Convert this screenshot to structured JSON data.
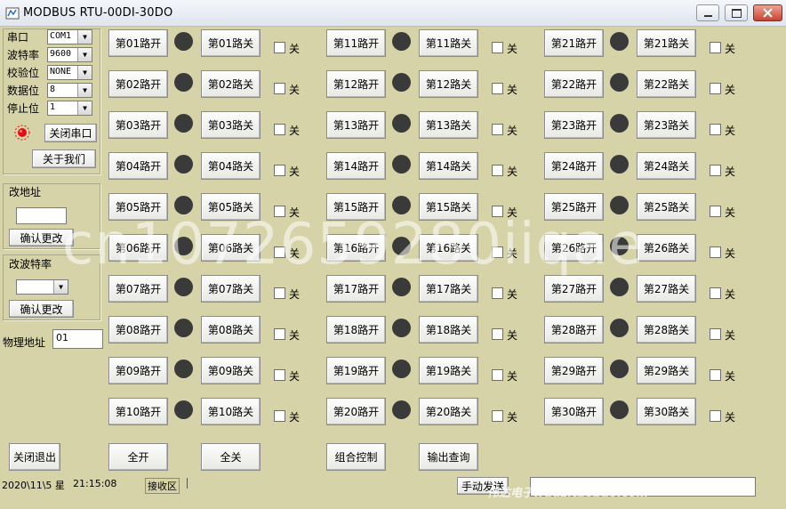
{
  "window": {
    "title": "MODBUS RTU-00DI-30DO",
    "controls": [
      "minimize-icon",
      "maximize-icon",
      "close-icon"
    ]
  },
  "serial": {
    "port_label": "串口",
    "port_value": "COM1",
    "baud_label": "波特率",
    "baud_value": "9600",
    "parity_label": "校验位",
    "parity_value": "NONE",
    "databits_label": "数据位",
    "databits_value": "8",
    "stopbits_label": "停止位",
    "stopbits_value": "1",
    "close_port_label": "关闭串口",
    "about_label": "关于我们",
    "status_led_color": "#e01010"
  },
  "change_address": {
    "title": "改地址",
    "value": "",
    "confirm_label": "确认更改"
  },
  "change_baud": {
    "title": "改波特率",
    "value": "",
    "confirm_label": "确认更改"
  },
  "physical_address": {
    "label": "物理地址",
    "value": "01"
  },
  "channels": [
    {
      "on": "第01路开",
      "off": "第01路关",
      "chk": "关"
    },
    {
      "on": "第02路开",
      "off": "第02路关",
      "chk": "关"
    },
    {
      "on": "第03路开",
      "off": "第03路关",
      "chk": "关"
    },
    {
      "on": "第04路开",
      "off": "第04路关",
      "chk": "关"
    },
    {
      "on": "第05路开",
      "off": "第05路关",
      "chk": "关"
    },
    {
      "on": "第06路开",
      "off": "第06路关",
      "chk": "关"
    },
    {
      "on": "第07路开",
      "off": "第07路关",
      "chk": "关"
    },
    {
      "on": "第08路开",
      "off": "第08路关",
      "chk": "关"
    },
    {
      "on": "第09路开",
      "off": "第09路关",
      "chk": "关"
    },
    {
      "on": "第10路开",
      "off": "第10路关",
      "chk": "关"
    },
    {
      "on": "第11路开",
      "off": "第11路关",
      "chk": "关"
    },
    {
      "on": "第12路开",
      "off": "第12路关",
      "chk": "关"
    },
    {
      "on": "第13路开",
      "off": "第13路关",
      "chk": "关"
    },
    {
      "on": "第14路开",
      "off": "第14路关",
      "chk": "关"
    },
    {
      "on": "第15路开",
      "off": "第15路关",
      "chk": "关"
    },
    {
      "on": "第16路开",
      "off": "第16路关",
      "chk": "关"
    },
    {
      "on": "第17路开",
      "off": "第17路关",
      "chk": "关"
    },
    {
      "on": "第18路开",
      "off": "第18路关",
      "chk": "关"
    },
    {
      "on": "第19路开",
      "off": "第19路关",
      "chk": "关"
    },
    {
      "on": "第20路开",
      "off": "第20路关",
      "chk": "关"
    },
    {
      "on": "第21路开",
      "off": "第21路关",
      "chk": "关"
    },
    {
      "on": "第22路开",
      "off": "第22路关",
      "chk": "关"
    },
    {
      "on": "第23路开",
      "off": "第23路关",
      "chk": "关"
    },
    {
      "on": "第24路开",
      "off": "第24路关",
      "chk": "关"
    },
    {
      "on": "第25路开",
      "off": "第25路关",
      "chk": "关"
    },
    {
      "on": "第26路开",
      "off": "第26路关",
      "chk": "关"
    },
    {
      "on": "第27路开",
      "off": "第27路关",
      "chk": "关"
    },
    {
      "on": "第28路开",
      "off": "第28路关",
      "chk": "关"
    },
    {
      "on": "第29路开",
      "off": "第29路关",
      "chk": "关"
    },
    {
      "on": "第30路开",
      "off": "第30路关",
      "chk": "关"
    }
  ],
  "bottom": {
    "exit_label": "关闭退出",
    "all_on_label": "全开",
    "all_off_label": "全关",
    "combo_label": "组合控制",
    "query_label": "输出查询",
    "manual_send_label": "手动发送",
    "manual_send_value": ""
  },
  "statusbar": {
    "date": "2020\\11\\5 星",
    "time": "21:15:08",
    "receive_label": "接收区"
  },
  "watermark": {
    "main": "cn1072659280iiqae",
    "shop": "伟达电子wddz.taobao.com"
  }
}
